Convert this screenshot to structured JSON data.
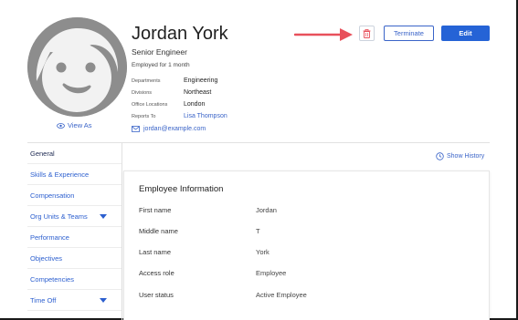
{
  "profile": {
    "name": "Jordan York",
    "job_title": "Senior Engineer",
    "tenure": "Employed for 1 month",
    "view_as": "View As",
    "email": "jordan@example.com",
    "facts": [
      {
        "label": "Departments",
        "value": "Engineering",
        "is_link": false
      },
      {
        "label": "Divisions",
        "value": "Northeast",
        "is_link": false
      },
      {
        "label": "Office Locations",
        "value": "London",
        "is_link": false
      },
      {
        "label": "Reports To",
        "value": "Lisa Thompson",
        "is_link": true
      }
    ]
  },
  "actions": {
    "delete_icon": "trash-icon",
    "terminate_label": "Terminate",
    "edit_label": "Edit"
  },
  "sidebar": {
    "items": [
      {
        "label": "General",
        "active": true,
        "has_caret": false
      },
      {
        "label": "Skills & Experience",
        "active": false,
        "has_caret": false
      },
      {
        "label": "Compensation",
        "active": false,
        "has_caret": false
      },
      {
        "label": "Org Units & Teams",
        "active": false,
        "has_caret": true
      },
      {
        "label": "Performance",
        "active": false,
        "has_caret": false
      },
      {
        "label": "Objectives",
        "active": false,
        "has_caret": false
      },
      {
        "label": "Competencies",
        "active": false,
        "has_caret": false
      },
      {
        "label": "Time Off",
        "active": false,
        "has_caret": true
      }
    ]
  },
  "main": {
    "show_history": "Show History",
    "card_title": "Employee Information",
    "fields": [
      {
        "label": "First name",
        "value": "Jordan"
      },
      {
        "label": "Middle name",
        "value": "T"
      },
      {
        "label": "Last name",
        "value": "York"
      },
      {
        "label": "Access role",
        "value": "Employee"
      },
      {
        "label": "User status",
        "value": "Active Employee"
      }
    ]
  },
  "colors": {
    "accent": "#2563d6",
    "link": "#3a64c8",
    "annotation_arrow": "#e8505b",
    "avatar_bg": "#8d8d8d"
  }
}
